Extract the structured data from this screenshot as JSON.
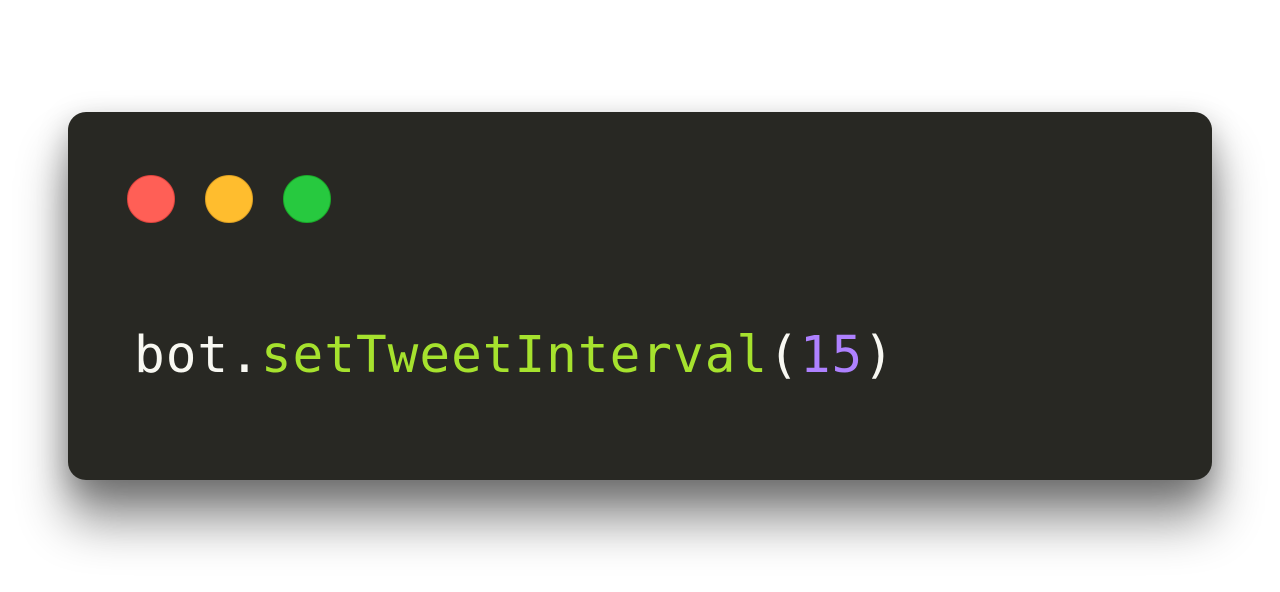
{
  "window": {
    "controls": [
      {
        "name": "close",
        "color": "#ff5f56"
      },
      {
        "name": "minimize",
        "color": "#ffbd2e"
      },
      {
        "name": "maximize",
        "color": "#27c93f"
      }
    ]
  },
  "code": {
    "object": "bot",
    "dot": ".",
    "method": "setTweetInterval",
    "open_paren": "(",
    "argument": "15",
    "close_paren": ")"
  },
  "colors": {
    "background": "#282823",
    "text": "#f8f8f2",
    "function": "#a6e22e",
    "number": "#ae81ff"
  }
}
